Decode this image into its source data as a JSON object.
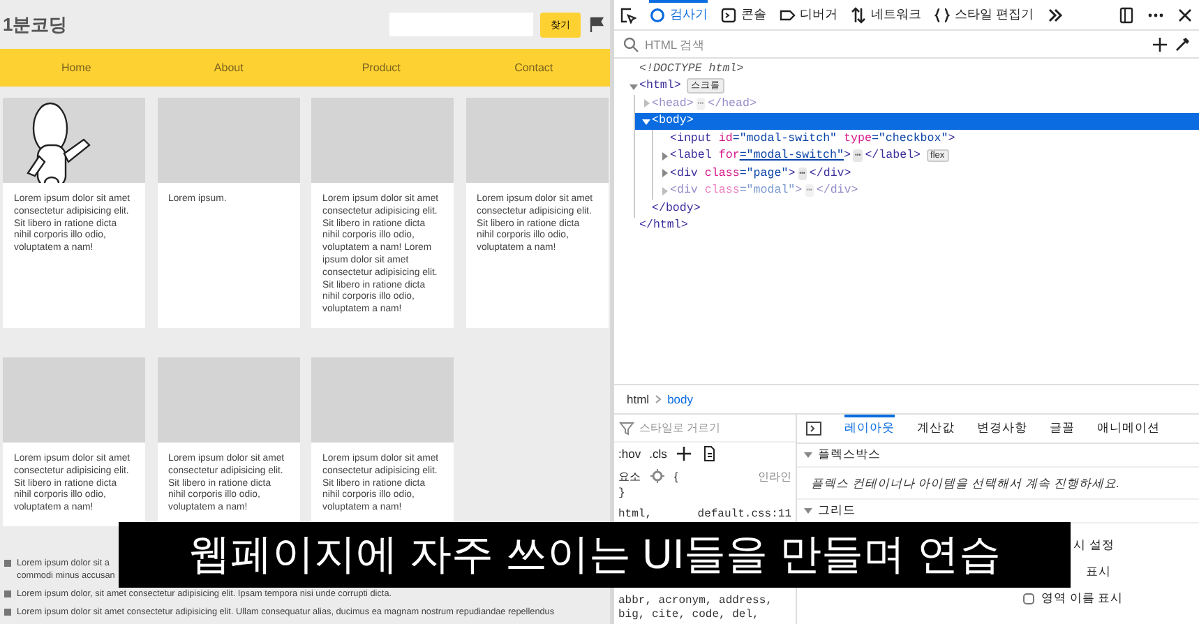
{
  "page": {
    "logo": "1분코딩",
    "search_button": "찾기",
    "nav": [
      {
        "label": "Home"
      },
      {
        "label": "About"
      },
      {
        "label": "Product"
      },
      {
        "label": "Contact"
      }
    ],
    "cards": [
      {
        "kind": "picture",
        "text": "Lorem ipsum dolor sit amet consectetur adipisicing elit. Sit libero in ratione dicta nihil corporis illo odio, voluptatem a nam!"
      },
      {
        "kind": "plain",
        "text": "Lorem ipsum."
      },
      {
        "kind": "plain",
        "text": "Lorem ipsum dolor sit amet consectetur adipisicing elit. Sit libero in ratione dicta nihil corporis illo odio, voluptatem a nam! Lorem ipsum dolor sit amet consectetur adipisicing elit. Sit libero in ratione dicta nihil corporis illo odio, voluptatem a nam!"
      },
      {
        "kind": "plain",
        "text": "Lorem ipsum dolor sit amet consectetur adipisicing elit. Sit libero in ratione dicta nihil corporis illo odio, voluptatem a nam!"
      },
      {
        "kind": "plain",
        "text": "Lorem ipsum dolor sit amet consectetur adipisicing elit. Sit libero in ratione dicta nihil corporis illo odio, voluptatem a nam!"
      },
      {
        "kind": "plain",
        "text": "Lorem ipsum dolor sit amet consectetur adipisicing elit. Sit libero in ratione dicta nihil corporis illo odio, voluptatem a nam!"
      },
      {
        "kind": "plain",
        "text": "Lorem ipsum dolor sit amet consectetur adipisicing elit. Sit libero in ratione dicta nihil corporis illo odio, voluptatem a nam!"
      }
    ],
    "list": [
      {
        "lines": [
          "Lorem ipsum dolor sit a",
          "commodi minus accusan"
        ]
      },
      {
        "lines": [
          "Lorem ipsum dolor, sit amet consectetur adipisicing elit. Ipsam tempora nisi unde corrupti dicta."
        ]
      },
      {
        "lines": [
          "Lorem ipsum dolor sit amet consectetur adipisicing elit. Ullam consequatur alias, ducimus ea magnam nostrum repudiandae repellendus"
        ]
      }
    ]
  },
  "devtools": {
    "tabs": [
      {
        "kind": "inspector",
        "label": "검사기",
        "selected": true
      },
      {
        "kind": "console",
        "label": "콘솔",
        "selected": false
      },
      {
        "kind": "debugger",
        "label": "디버거",
        "selected": false
      },
      {
        "kind": "network",
        "label": "네트워크",
        "selected": false
      },
      {
        "kind": "style",
        "label": "스타일 편집기",
        "selected": false
      }
    ],
    "search": {
      "placeholder": "HTML 검색"
    },
    "tree": [
      {
        "kind": "doctype",
        "text": "<!DOCTYPE html>",
        "selected": false
      },
      {
        "kind": "element",
        "tag": "<html",
        "tag_end": ">",
        "badge": "스크롤",
        "expanded": true,
        "selected": false,
        "dimmed": false,
        "close": "</html>",
        "children": [
          {
            "kind": "element",
            "tag": "<head",
            "tag_end": ">",
            "ellipsis": "⋯",
            "inline_close": "</head>",
            "expanded": false,
            "selected": false,
            "dimmed": true
          },
          {
            "kind": "element",
            "tag": "<body",
            "tag_end": ">",
            "expanded": true,
            "selected": true,
            "dimmed": false,
            "close": "</body>",
            "children": [
              {
                "kind": "leaf",
                "tag": "<input",
                "attrs": [
                  {
                    "name": "id",
                    "value": "=\"modal-switch\"",
                    "link": false
                  },
                  {
                    "name": "type",
                    "value": "=\"checkbox\"",
                    "link": false
                  }
                ],
                "tag_end": ">",
                "selected": false,
                "dimmed": false
              },
              {
                "kind": "element",
                "tag": "<label",
                "attrs": [
                  {
                    "name": "for",
                    "value": "=\"modal-switch\"",
                    "link": true
                  }
                ],
                "tag_end": ">",
                "ellipsis": "⋯",
                "inline_close": "</label>",
                "badge": "flex",
                "expanded": false,
                "selected": false,
                "dimmed": false
              },
              {
                "kind": "element",
                "tag": "<div",
                "attrs": [
                  {
                    "name": "class",
                    "value": "=\"page\"",
                    "link": false
                  }
                ],
                "tag_end": ">",
                "ellipsis": "⋯",
                "inline_close": "</div>",
                "expanded": false,
                "selected": false,
                "dimmed": false
              },
              {
                "kind": "element",
                "tag": "<div",
                "attrs": [
                  {
                    "name": "class",
                    "value": "=\"modal\"",
                    "link": false
                  }
                ],
                "tag_end": ">",
                "ellipsis": "⋯",
                "inline_close": "</div>",
                "expanded": false,
                "selected": false,
                "dimmed": true
              }
            ]
          }
        ]
      }
    ],
    "breadcrumb": [
      {
        "label": "html",
        "selected": false
      },
      {
        "label": "body",
        "selected": true
      }
    ],
    "rules": {
      "filter": {
        "placeholder": "스타일로 거르기"
      },
      "hov": ":hov",
      "cls": ".cls",
      "element_label": "요소",
      "brace_open": "{",
      "inline": "인라인",
      "brace_close": "}",
      "selector": "html,",
      "source": "default.css:11",
      "lines": [
        "abbr, acronym, address,",
        "big, cite, code, del,"
      ]
    },
    "side_tabs": [
      {
        "label": "레이아웃",
        "selected": true
      },
      {
        "label": "계산값",
        "selected": false
      },
      {
        "label": "변경사항",
        "selected": false
      },
      {
        "label": "글꼴",
        "selected": false
      },
      {
        "label": "애니메이션",
        "selected": false
      }
    ],
    "flexbox": {
      "title": "플렉스박스",
      "expanded": true,
      "message": "플렉스 컨테이너나 아이템을 선택해서 계속 진행하세요."
    },
    "grid": {
      "title": "그리드",
      "expanded": true,
      "options": [
        {
          "kind": "heading",
          "label": "시 설정"
        },
        {
          "kind": "text",
          "label": "표시"
        },
        {
          "kind": "checkbox",
          "label": "영역 이름 표시",
          "checked": false
        }
      ]
    }
  },
  "caption": "웹페이지에 자주 쓰이는 UI들을 만들며 연습"
}
